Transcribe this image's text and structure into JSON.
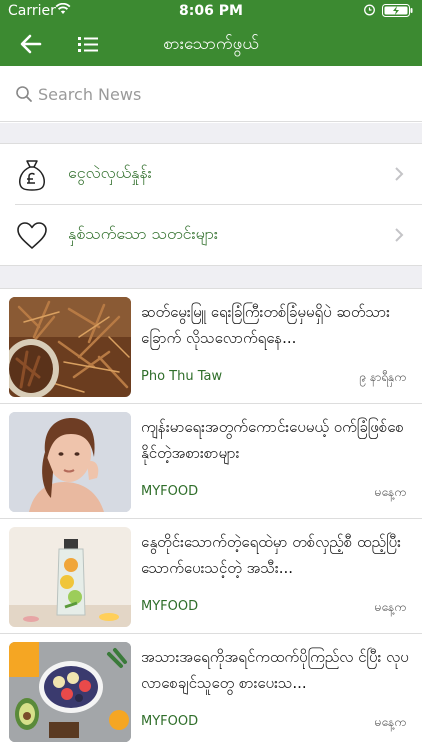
{
  "status_bar": {
    "carrier": "Carrier",
    "time": "8:06 PM"
  },
  "navbar": {
    "title": "စားသောက်ဖွယ်"
  },
  "search": {
    "placeholder": "Search News"
  },
  "menu": [
    {
      "label": "ငွေလဲလှယ်နှုန်း",
      "icon": "money-bag-icon"
    },
    {
      "label": "နှစ်သက်သော သတင်းများ",
      "icon": "heart-icon"
    }
  ],
  "news": [
    {
      "title": "ဆတ်မွေးမြူ ရေးခြံကြီးတစ်ခြံမှမရှိပဲ ဆတ်သားခြောက် လိုသလောက်ရနေ...",
      "source": "Pho Thu Taw",
      "time": "၉ နာရီနှက"
    },
    {
      "title": "ကျန်းမာရေးအတွက်ကောင်းပေမယ့် ဝက်ခြံဖြစ်စေနိုင်တဲ့အစားစာများ",
      "source": "MYFOOD",
      "time": "မနေ့က"
    },
    {
      "title": "နွေတိုင်းသောက်တဲ့ရေထဲမှာ တစ်လှည့်စီ ထည့်ပြီးသောက်ပေးသင့်တဲ့ အသီး...",
      "source": "MYFOOD",
      "time": "မနေ့က"
    },
    {
      "title": "အသားအရေကိုအရင်ကထက်ပိုကြည်လ င်ပြီး လုပလာစေချင်သူတွေ စားပေးသ...",
      "source": "MYFOOD",
      "time": "မနေ့က"
    }
  ],
  "colors": {
    "header": "#3c8a31",
    "accent_text": "#2f6e2a",
    "section_bg": "#efeff3"
  }
}
